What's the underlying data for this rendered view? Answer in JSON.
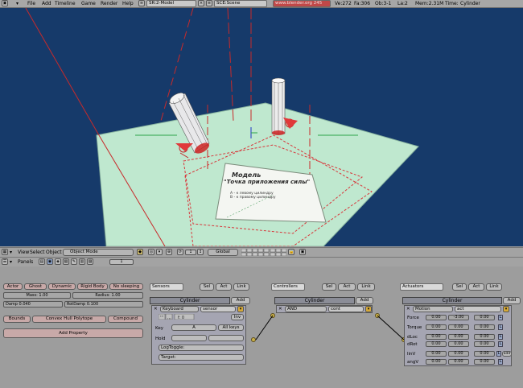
{
  "topbar": {
    "menu": [
      "File",
      "Add",
      "Timeline",
      "Game",
      "Render",
      "Help"
    ],
    "screen_field": "SR:2-Model",
    "scene_field": "SCE:Scene",
    "url": "www.blender.org 245",
    "stats": [
      "Ve:272",
      "Fa:306",
      "Ob:3-1",
      "La:2",
      "Mem:2.31M",
      "Time:",
      "Cylinder"
    ]
  },
  "viewport_header": {
    "menu": [
      "View",
      "Select",
      "Object"
    ],
    "mode": "Object Mode",
    "pivot_field": "1",
    "orientation": "Global"
  },
  "scene_text": {
    "title": "Модель",
    "subtitle": "\"Точка приложения силы\"",
    "line1": "A - к левому цилиндру",
    "line2": "B - к правому цилиндру"
  },
  "buttons_header": {
    "panels_label": "Panels",
    "frame_field": "1"
  },
  "physics_panel": {
    "tabs": [
      "Actor",
      "Ghost",
      "Dynamic",
      "Rigid Body",
      "No sleeping"
    ],
    "mass": "Mass: 1.00",
    "radius": "Radius: 1.00",
    "damp": "Damp 0.040",
    "rotdamp": "RotDamp 0.100",
    "bounds_btn": "Bounds",
    "bounds_type": "Convex Hull Polytope",
    "compound_btn": "Compound",
    "add_property": "Add Property"
  },
  "sensors": {
    "label": "Sensors",
    "filter": [
      "Sel",
      "Act",
      "Link"
    ],
    "object_name": "Cylinder",
    "add": "Add",
    "type": "Keyboard",
    "name": "sensor",
    "inv": "Inv",
    "key_label": "Key",
    "key_value": "A",
    "allkeys": "All keys",
    "hold_label": "Hold",
    "logtoggle": "LogToggle:",
    "target": "Target:"
  },
  "controllers": {
    "label": "Controllers",
    "filter": [
      "Sel",
      "Act",
      "Link"
    ],
    "object_name": "Cylinder",
    "add": "Add",
    "type": "AND",
    "name": "cont"
  },
  "actuators": {
    "label": "Actuators",
    "filter": [
      "Sel",
      "Act",
      "Link"
    ],
    "object_name": "Cylinder",
    "add": "Add",
    "type": "Motion",
    "name": "act",
    "rows": [
      {
        "label": "Force",
        "values": [
          "0.00",
          "-3.00",
          "0.00"
        ],
        "flag": "L"
      },
      {
        "label": "Torque",
        "values": [
          "0.00",
          "0.00",
          "0.00"
        ],
        "flag": "L"
      },
      {
        "label": "dLoc",
        "values": [
          "0.00",
          "0.00",
          "0.00"
        ],
        "flag": "L"
      },
      {
        "label": "dRot",
        "values": [
          "0.00",
          "0.00",
          "0.00"
        ],
        "flag": "L"
      },
      {
        "label": "linV",
        "values": [
          "0.00",
          "0.00",
          "0.00"
        ],
        "flag": "L",
        "extra": "add"
      },
      {
        "label": "angV",
        "values": [
          "0.00",
          "0.00",
          "0.00"
        ],
        "flag": "L"
      }
    ]
  }
}
